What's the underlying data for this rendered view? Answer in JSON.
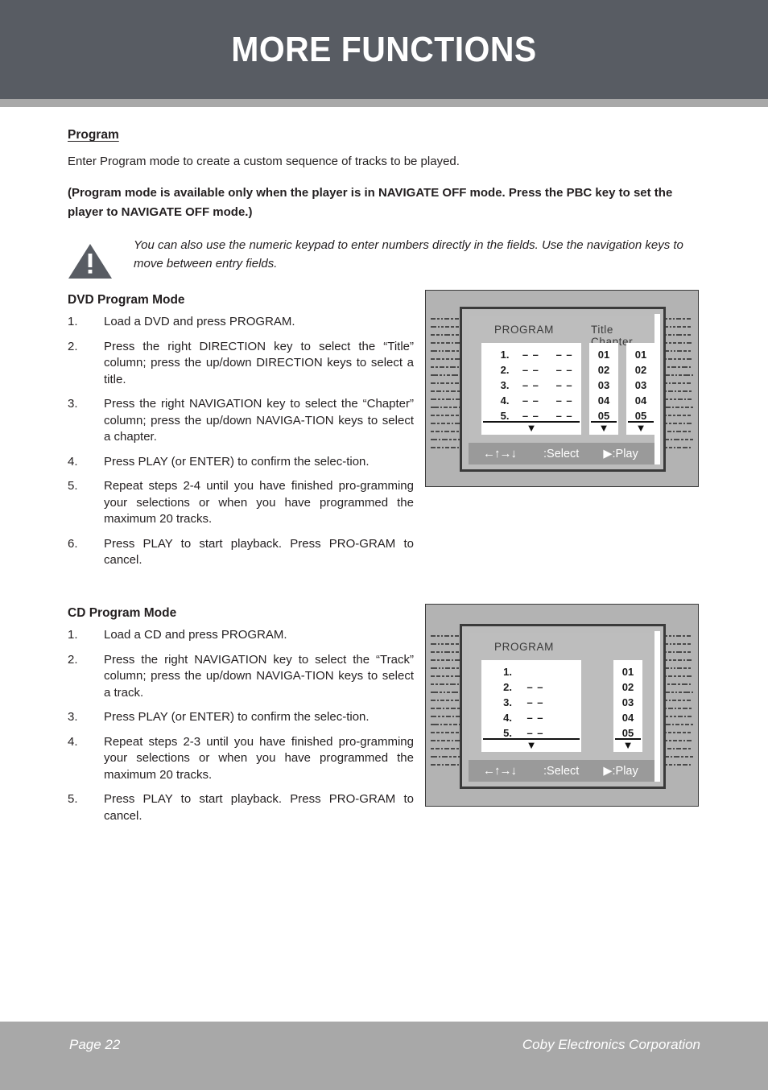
{
  "header": {
    "title": "MORE FUNCTIONS",
    "bg_color": "#585c63",
    "rule_color": "#a8a8a8"
  },
  "program_section": {
    "heading": "Program",
    "intro": "Enter Program mode to create a custom sequence of tracks to be played.",
    "bold_note": "(Program mode is available only when the player is in NAVIGATE OFF mode. Press the PBC key to set the player to NAVIGATE OFF mode.)",
    "note": {
      "icon": "warning-triangle-icon",
      "text": "You can also use the numeric keypad to enter numbers directly in the fields. Use the navigation keys to move between entry fields."
    }
  },
  "dvd_section": {
    "heading": "DVD Program Mode",
    "steps": [
      {
        "num": "1.",
        "text": "Load a DVD and press PROGRAM."
      },
      {
        "num": "2.",
        "text": "Press the right DIRECTION key to select the “Title” column; press the up/down DIRECTION keys to select a title."
      },
      {
        "num": "3.",
        "text": "Press the right NAVIGATION key to select the “Chapter” column; press the up/down NAVIGA-TION keys to select a chapter."
      },
      {
        "num": "4.",
        "text": "Press PLAY (or ENTER) to confirm the selec-tion."
      },
      {
        "num": "5.",
        "text": "Repeat steps 2-4 until you have finished pro-gramming your selections or when you have programmed the maximum 20 tracks."
      },
      {
        "num": "6.",
        "text": "Press PLAY to start playback. Press PRO-GRAM to cancel."
      }
    ]
  },
  "cd_section": {
    "heading": "CD Program Mode",
    "steps": [
      {
        "num": "1.",
        "text": "Load a CD and press PROGRAM."
      },
      {
        "num": "2.",
        "text": "Press the right NAVIGATION key to select the “Track” column; press the up/down NAVIGA-TION keys to select a track."
      },
      {
        "num": "3.",
        "text": "Press PLAY (or ENTER) to confirm the selec-tion."
      },
      {
        "num": "4.",
        "text": "Repeat steps 2-3 until you have finished pro-gramming your selections or when you have programmed the maximum 20 tracks."
      },
      {
        "num": "5.",
        "text": "Press PLAY to start playback. Press PRO-GRAM to cancel."
      }
    ]
  },
  "dvd_screen": {
    "program_label": "PROGRAM",
    "columns_label": "Title Chapter",
    "rows": [
      {
        "n": "1.",
        "a": "– –",
        "b": "– –"
      },
      {
        "n": "2.",
        "a": "– –",
        "b": "– –"
      },
      {
        "n": "3.",
        "a": "– –",
        "b": "– –"
      },
      {
        "n": "4.",
        "a": "– –",
        "b": "– –"
      },
      {
        "n": "5.",
        "a": "– –",
        "b": "– –"
      }
    ],
    "title_values": [
      "01",
      "02",
      "03",
      "04",
      "05"
    ],
    "chapter_values": [
      "01",
      "02",
      "03",
      "04",
      "05"
    ],
    "scroll_caret": "▼",
    "footbar": {
      "arrows": "←↑→↓",
      "select": ":Select",
      "play": "▶:Play"
    }
  },
  "cd_screen": {
    "program_label": "PROGRAM",
    "rows": [
      {
        "n": "1.",
        "a": ""
      },
      {
        "n": "2.",
        "a": "– –"
      },
      {
        "n": "3.",
        "a": "– –"
      },
      {
        "n": "4.",
        "a": "– –"
      },
      {
        "n": "5.",
        "a": "– –"
      }
    ],
    "track_values": [
      "01",
      "02",
      "03",
      "04",
      "05"
    ],
    "scroll_caret": "▼",
    "footbar": {
      "arrows": "←↑→↓",
      "select": ":Select",
      "play": "▶:Play"
    }
  },
  "footer": {
    "page": "Page 22",
    "company": "Coby Electronics Corporation",
    "bg_color": "#a8a8a8"
  }
}
